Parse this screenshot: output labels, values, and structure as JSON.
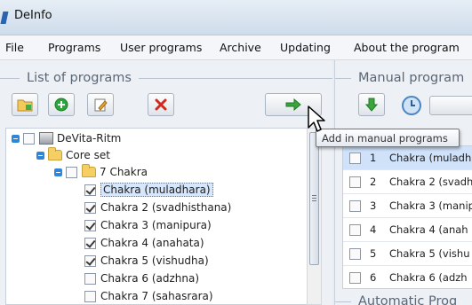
{
  "window": {
    "title": "DeInfo"
  },
  "menu": [
    "File",
    "Programs",
    "User programs",
    "Archive",
    "Updating",
    "About the program"
  ],
  "left_panel": {
    "header": "List of programs",
    "toolbar": [
      {
        "name": "open-folder-icon",
        "color": "#e2a93b"
      },
      {
        "name": "add-icon",
        "color": "#2aa63c"
      },
      {
        "name": "edit-icon",
        "color": "#d99a2b"
      },
      {
        "name": "delete-icon",
        "color": "#d2281d"
      },
      {
        "name": "arrow-right-icon",
        "color": "#3aa53a"
      }
    ],
    "tree": {
      "root": "DeVita-Ritm",
      "set": "Core set",
      "group": "7 Chakra",
      "items": [
        {
          "label": "Chakra (muladhara)",
          "checked": true,
          "selected": true
        },
        {
          "label": "Chakra 2 (svadhisthana)",
          "checked": true
        },
        {
          "label": "Chakra 3 (manipura)",
          "checked": true
        },
        {
          "label": "Chakra 4 (anahata)",
          "checked": true
        },
        {
          "label": "Chakra 5 (vishudha)",
          "checked": true
        },
        {
          "label": "Chakra 6 (adzhna)",
          "checked": false
        },
        {
          "label": "Chakra 7 (sahasrara)",
          "checked": false
        }
      ]
    }
  },
  "right_panel": {
    "header": "Manual program",
    "footer_header": "Automatic Prog",
    "rows": [
      {
        "num": "1",
        "label": "Chakra (muladh",
        "selected": true
      },
      {
        "num": "2",
        "label": "Chakra 2 (svadh"
      },
      {
        "num": "3",
        "label": "Chakra 3 (manip"
      },
      {
        "num": "4",
        "label": "Chakra 4 (anah"
      },
      {
        "num": "5",
        "label": "Chakra 5 (vishu"
      },
      {
        "num": "6",
        "label": "Chakra 6 (adzh"
      }
    ]
  },
  "tooltip": "Add in manual programs"
}
